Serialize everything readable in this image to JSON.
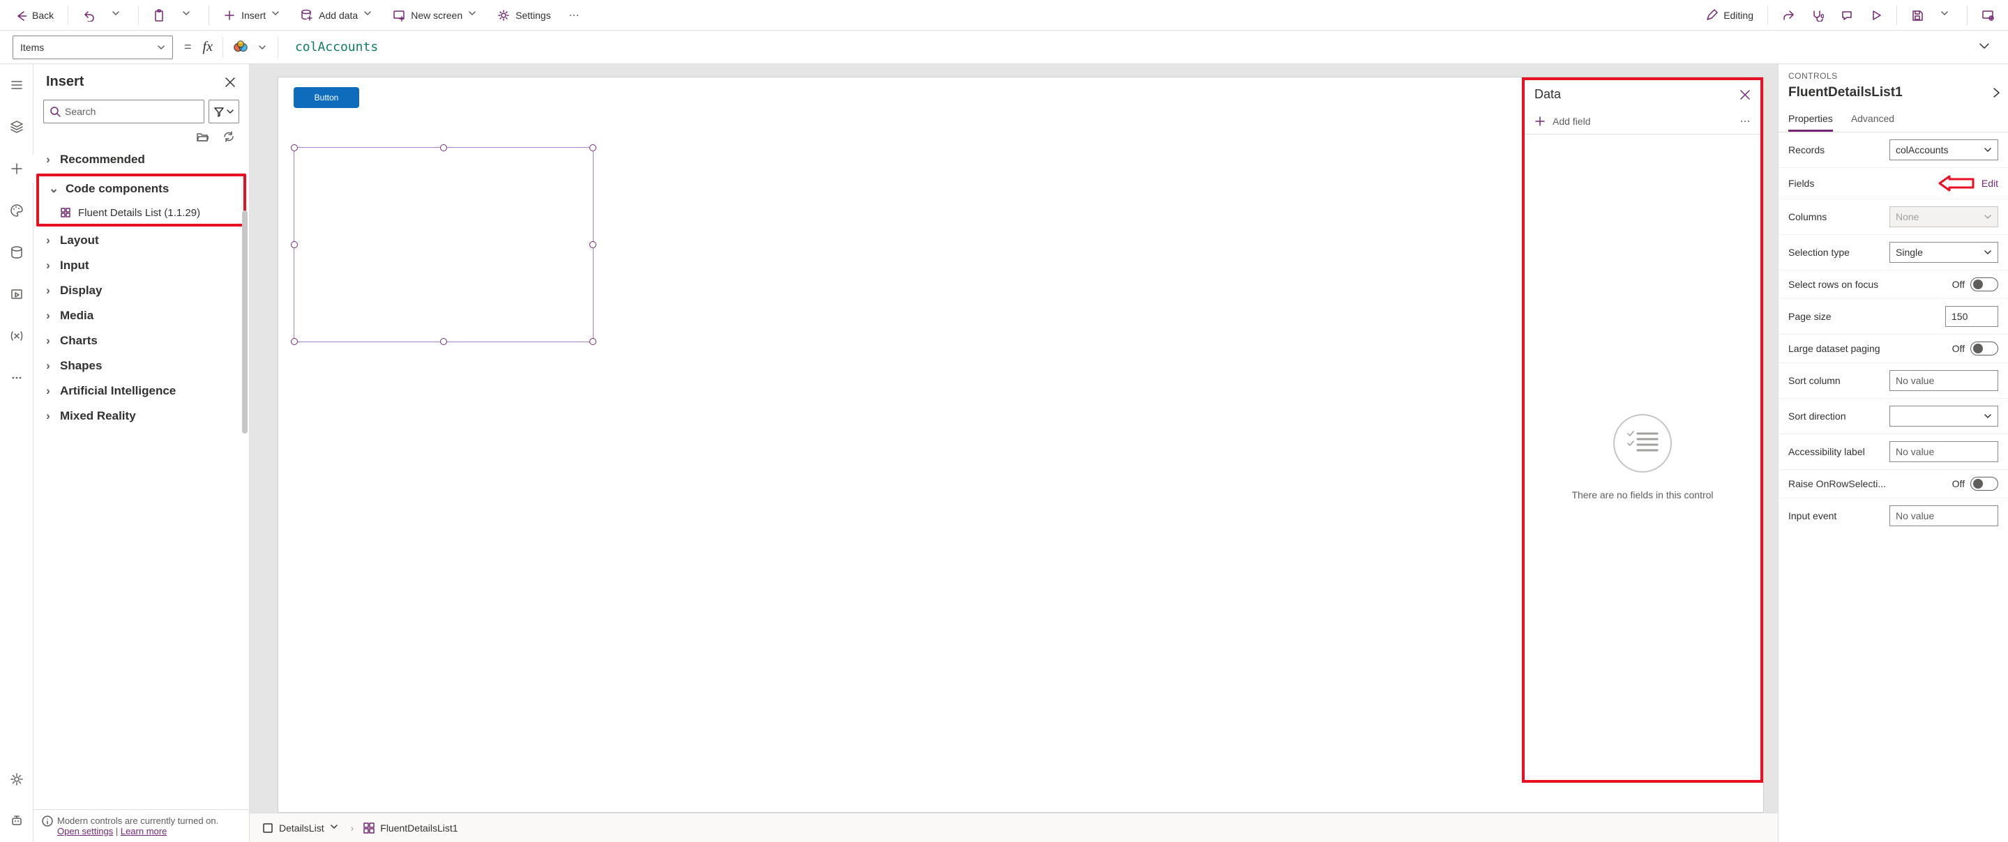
{
  "topbar": {
    "back": "Back",
    "insert": "Insert",
    "add_data": "Add data",
    "new_screen": "New screen",
    "settings": "Settings",
    "editing": "Editing"
  },
  "formula": {
    "property": "Items",
    "expression": "colAccounts"
  },
  "insertPanel": {
    "title": "Insert",
    "search_placeholder": "Search",
    "categories": {
      "recommended": "Recommended",
      "code_components": "Code components",
      "fluent_details": "Fluent Details List (1.1.29)",
      "layout": "Layout",
      "input": "Input",
      "display": "Display",
      "media": "Media",
      "charts": "Charts",
      "shapes": "Shapes",
      "ai": "Artificial Intelligence",
      "mixed_reality": "Mixed Reality"
    },
    "info_text": "Modern controls are currently turned on.",
    "info_link1": "Open settings",
    "info_link2": "Learn more"
  },
  "canvas": {
    "button_label": "Button"
  },
  "dataFlyout": {
    "title": "Data",
    "add_field": "Add field",
    "empty": "There are no fields in this control"
  },
  "breadcrumb": {
    "item1": "DetailsList",
    "item2": "FluentDetailsList1"
  },
  "controls": {
    "section": "CONTROLS",
    "name": "FluentDetailsList1",
    "tabs": {
      "properties": "Properties",
      "advanced": "Advanced"
    },
    "records_label": "Records",
    "records_value": "colAccounts",
    "fields_label": "Fields",
    "fields_edit": "Edit",
    "columns_label": "Columns",
    "columns_value": "None",
    "selection_type_label": "Selection type",
    "selection_type_value": "Single",
    "select_rows_label": "Select rows on focus",
    "page_size_label": "Page size",
    "page_size_value": "150",
    "large_dataset_label": "Large dataset paging",
    "sort_column_label": "Sort column",
    "sort_direction_label": "Sort direction",
    "accessibility_label": "Accessibility label",
    "raise_onrow_label": "Raise OnRowSelecti...",
    "input_event_label": "Input event",
    "no_value": "No value",
    "off": "Off"
  }
}
